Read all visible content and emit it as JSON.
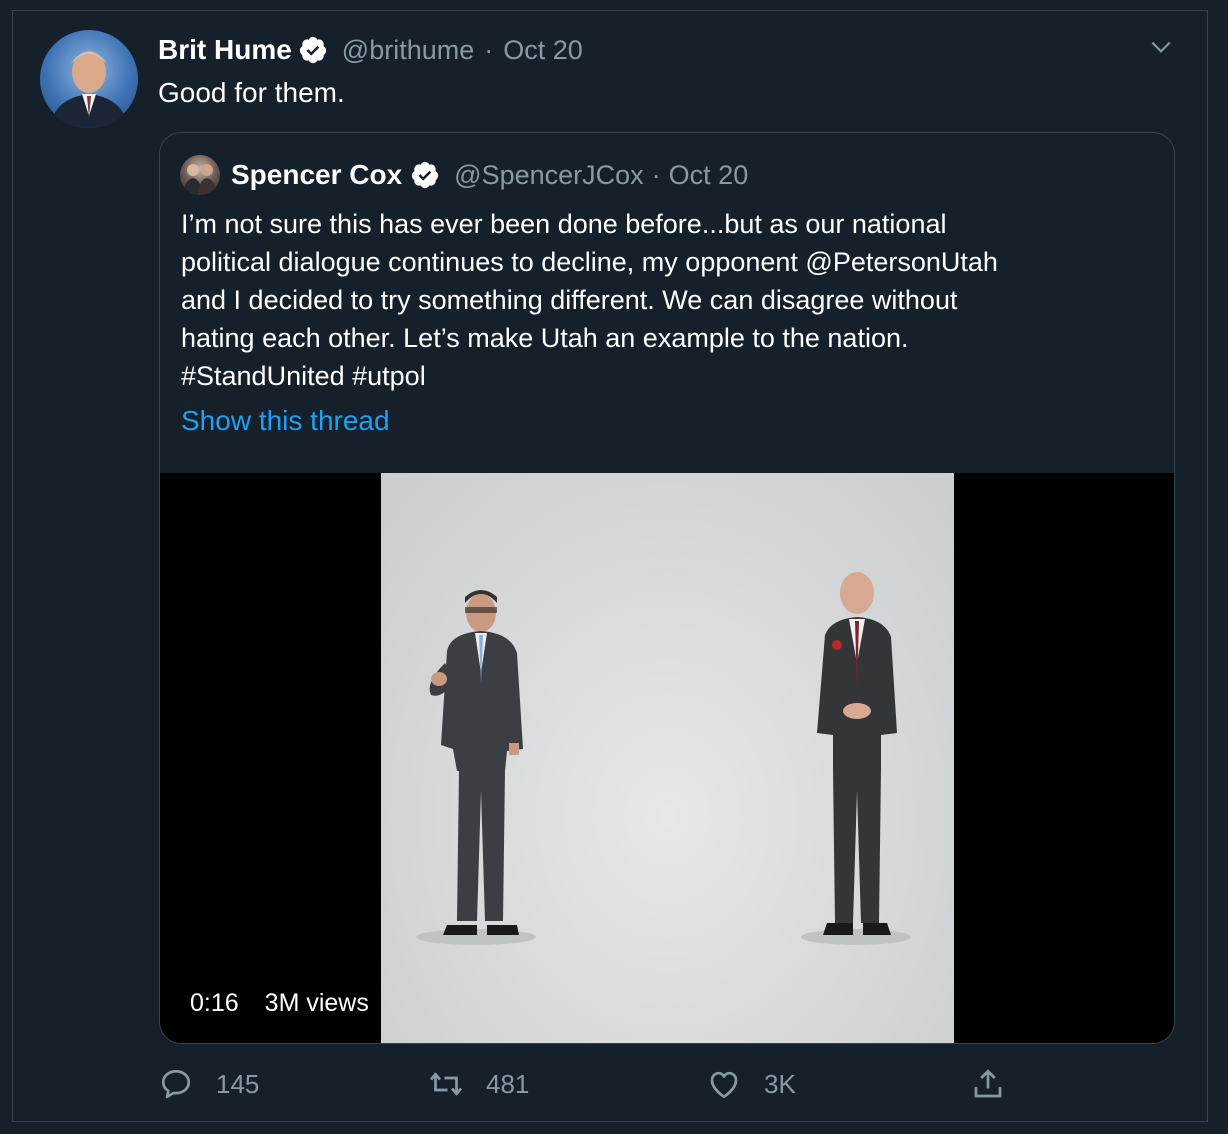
{
  "tweet": {
    "author_name": "Brit Hume",
    "author_handle": "@brithume",
    "separator": "·",
    "date": "Oct 20",
    "text": "Good for them."
  },
  "quoted_tweet": {
    "author_name": "Spencer Cox",
    "author_handle": "@SpencerJCox",
    "separator": "·",
    "date": "Oct 20",
    "text_lines": [
      "I’m not sure this has ever been done before...but as our national",
      "political dialogue continues to decline, my opponent @PetersonUtah",
      "and I decided to try something different. We can disagree without",
      "hating each other. Let’s make Utah an example to the nation.",
      "#StandUnited #utpol"
    ],
    "show_thread": "Show this thread",
    "video": {
      "duration": "0:16",
      "views": "3M views"
    }
  },
  "actions": {
    "replies": "145",
    "retweets": "481",
    "likes": "3K"
  },
  "colors": {
    "background": "#15202b",
    "border": "#38444d",
    "secondary_text": "#8899a6",
    "link": "#1da1f2"
  },
  "icons": [
    "verified-icon",
    "chevron-down-icon",
    "reply-icon",
    "retweet-icon",
    "like-icon",
    "share-icon"
  ]
}
